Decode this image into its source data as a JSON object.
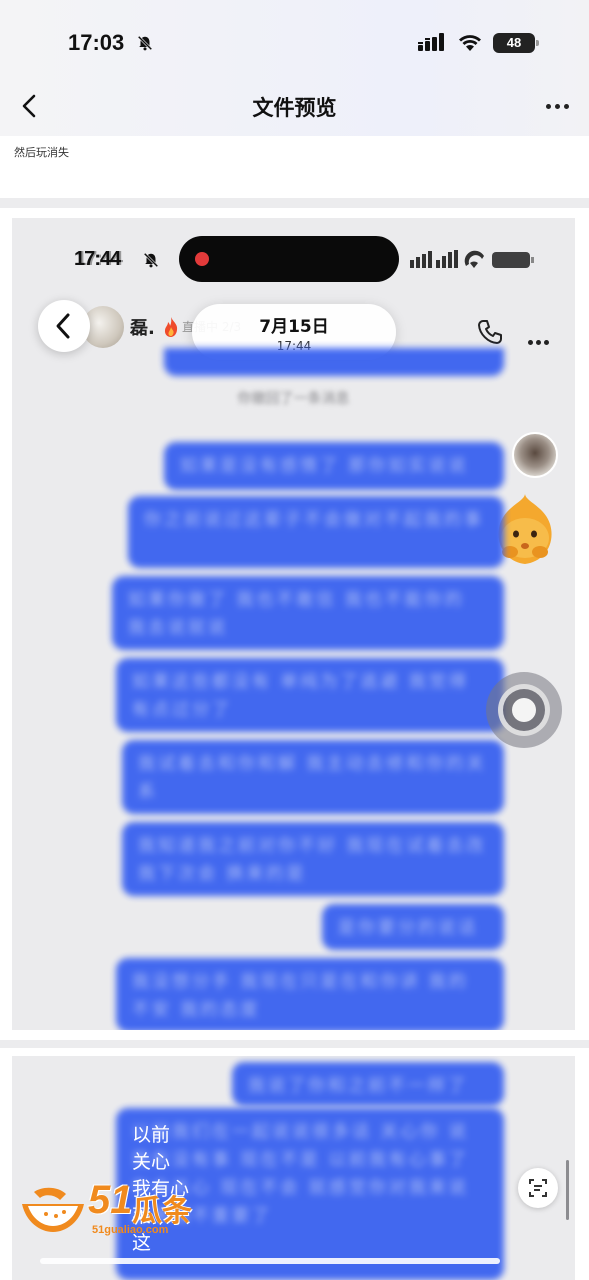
{
  "status_bar": {
    "time": "17:03",
    "battery": "48"
  },
  "nav": {
    "title": "文件预览"
  },
  "page1": {
    "trailing_text": "然后玩消失"
  },
  "screenshot": {
    "status_time": "17:44",
    "contact_name": "磊.",
    "contact_sub": "直播中 2/3",
    "date_main": "7月15日",
    "date_sub": "17:44",
    "recall_notice": "你撤回了一条消息",
    "blurred_bubbles": [
      "如果是没有感情了 那你如实说说",
      "你之前说过这辈子不会做对不起我的事",
      "如果你做了 我也不敢信 我也不能你的 我去说就说",
      "如果这些都没有 单纯为了逃避 我觉得有点过分了",
      "我试着去和你和解 我主动去修和你的关系",
      "我知道我之前对你不好 我现在试着去改 我下次会 换来的是",
      "是你要分的说话",
      "我没想分手 我现在只是在和你讲 我的不安 我的态度"
    ]
  },
  "page3": {
    "blurred_bubbles": [
      "我说了你和之前不一样了",
      "以前我们在一起说说很多话 关心你 说我有没有事 现在不是 以前我有心事了 你会关心 现在不会 就感觉你对我来说越来越不重要了"
    ],
    "clear_text_lines": [
      "以前",
      "关心",
      "我有心",
      "莱...",
      "这"
    ]
  },
  "watermark": {
    "number": "51",
    "brand": "瓜条",
    "url": "51gualiao.com"
  },
  "colors": {
    "bubble": "#3a62f0",
    "accent": "#f08a1e"
  }
}
